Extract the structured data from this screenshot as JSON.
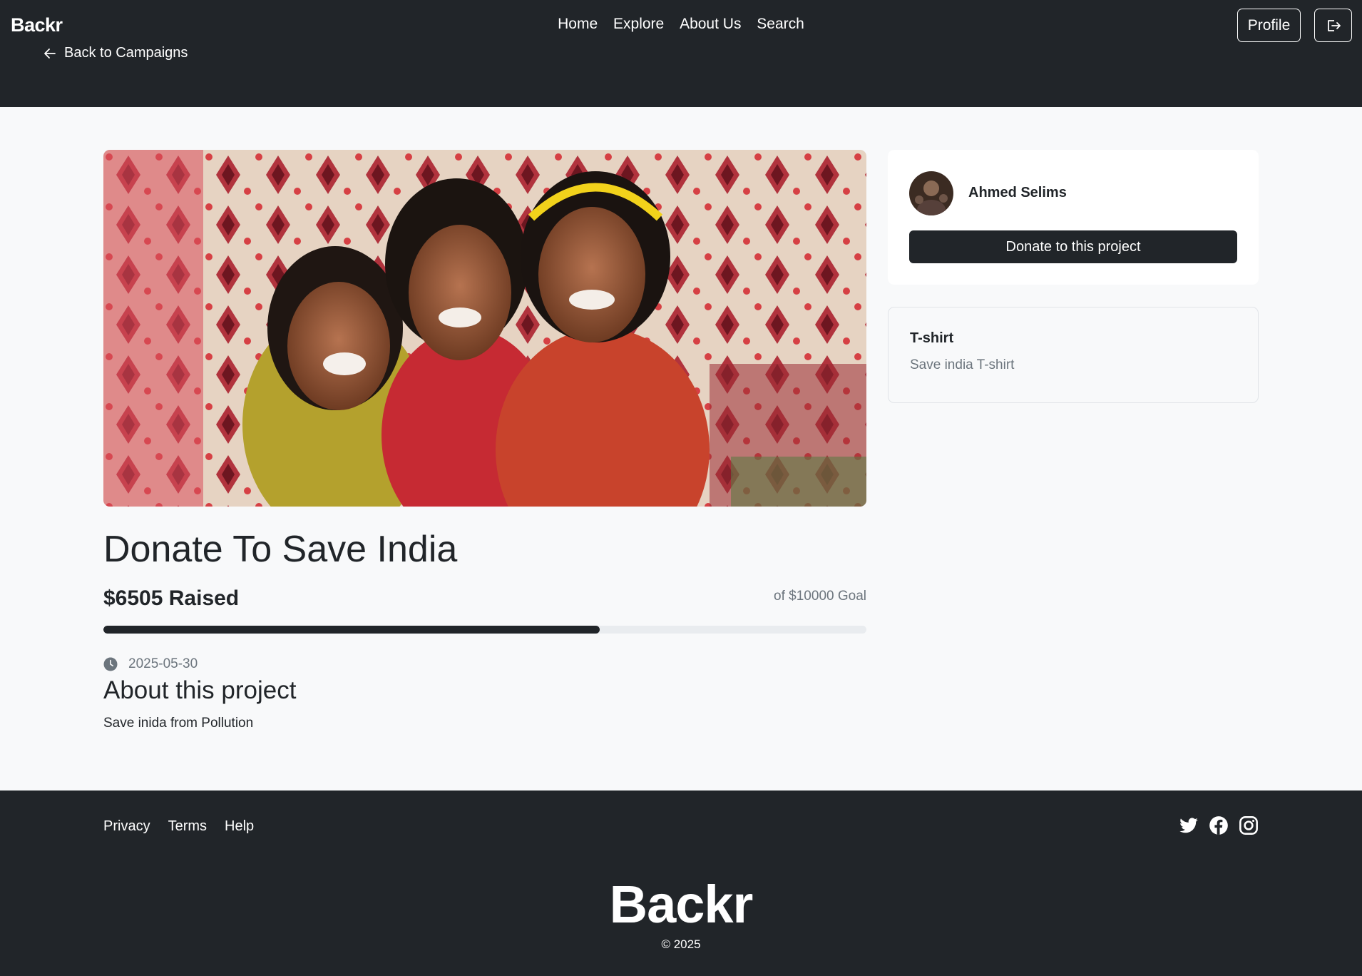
{
  "header": {
    "brand": "Backr",
    "nav": [
      "Home",
      "Explore",
      "About Us",
      "Search"
    ],
    "back_label": "Back to Campaigns",
    "profile_label": "Profile",
    "logout_icon": "logout-icon"
  },
  "campaign": {
    "title": "Donate To Save India",
    "raised_label": "$6505 Raised",
    "goal_label": "of $10000 Goal",
    "progress_fraction": 0.6505,
    "date": "2025-05-30",
    "about_heading": "About this project",
    "about_text": "Save inida from Pollution"
  },
  "creator": {
    "name": "Ahmed Selims",
    "donate_label": "Donate to this project"
  },
  "reward": {
    "title": "T-shirt",
    "description": "Save india T-shirt"
  },
  "footer": {
    "links": [
      "Privacy",
      "Terms",
      "Help"
    ],
    "social_icons": [
      "twitter-icon",
      "facebook-icon",
      "instagram-icon"
    ],
    "brand": "Backr",
    "copyright": "© 2025"
  },
  "colors": {
    "dark": "#212529",
    "background": "#f8f9fa",
    "muted": "#6c757d"
  }
}
